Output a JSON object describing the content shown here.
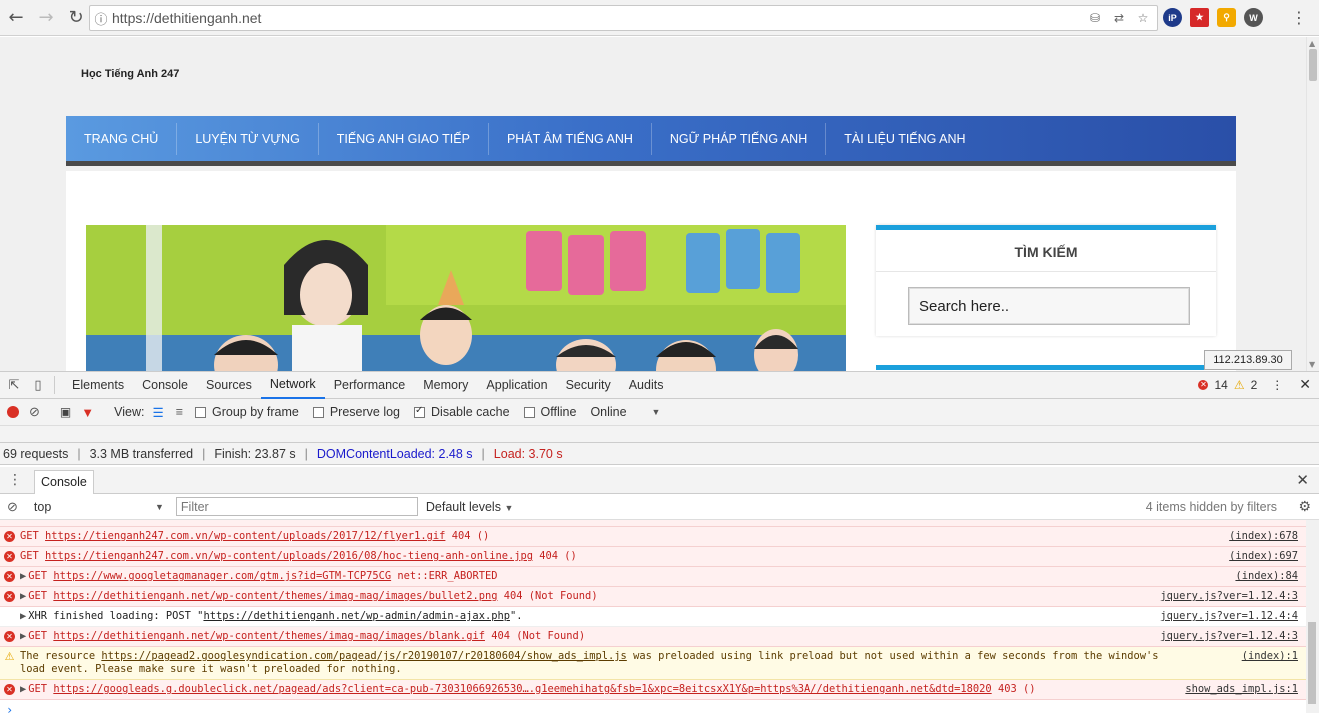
{
  "browser": {
    "url": "https://dethitienganh.net",
    "ext_labels": [
      "iP",
      "W"
    ]
  },
  "site": {
    "title": "Học Tiếng Anh 247",
    "nav": [
      "TRANG CHỦ",
      "LUYỆN TỪ VỰNG",
      "TIẾNG ANH GIAO TIẾP",
      "PHÁT ÂM TIẾNG ANH",
      "NGỮ PHÁP TIẾNG ANH",
      "TÀI LIỆU TIẾNG ANH"
    ],
    "widget_title": "TÌM KIẾM",
    "search_placeholder": "Search here..",
    "ip_tooltip": "112.213.89.30"
  },
  "devtools": {
    "tabs": [
      "Elements",
      "Console",
      "Sources",
      "Network",
      "Performance",
      "Memory",
      "Application",
      "Security",
      "Audits"
    ],
    "active_tab": "Network",
    "error_count": "14",
    "warning_count": "2",
    "network_toolbar": {
      "view_label": "View:",
      "group_by_frame": "Group by frame",
      "preserve_log": "Preserve log",
      "disable_cache": "Disable cache",
      "offline": "Offline",
      "throttle": "Online"
    },
    "summary": {
      "requests": "69 requests",
      "transferred": "3.3 MB transferred",
      "finish": "Finish: 23.87 s",
      "dcl": "DOMContentLoaded: 2.48 s",
      "load": "Load: 3.70 s"
    },
    "drawer_tab": "Console",
    "console_toolbar": {
      "context": "top",
      "filter_placeholder": "Filter",
      "levels": "Default levels",
      "hidden_note": "4 items hidden by filters"
    },
    "log": [
      {
        "type": "error",
        "expand": false,
        "method": "GET",
        "url": "https://tienganh247.com.vn/wp-content/uploads/2017/12/flyer1.gif",
        "status": "404 ()",
        "source": "(index):678"
      },
      {
        "type": "error",
        "expand": false,
        "method": "GET",
        "url": "https://tienganh247.com.vn/wp-content/uploads/2016/08/hoc-tieng-anh-online.jpg",
        "status": "404 ()",
        "source": "(index):697"
      },
      {
        "type": "error",
        "expand": true,
        "method": "GET",
        "url": "https://www.googletagmanager.com/gtm.js?id=GTM-TCP75CG",
        "status": "net::ERR_ABORTED",
        "source": "(index):84"
      },
      {
        "type": "error",
        "expand": true,
        "method": "GET",
        "url": "https://dethitienganh.net/wp-content/themes/imag-mag/images/bullet2.png",
        "status": "404 (Not Found)",
        "source": "jquery.js?ver=1.12.4:3"
      },
      {
        "type": "info",
        "expand": true,
        "text_pre": "XHR finished loading: POST \"",
        "url": "https://dethitienganh.net/wp-admin/admin-ajax.php",
        "text_post": "\".",
        "source": "jquery.js?ver=1.12.4:4"
      },
      {
        "type": "error",
        "expand": true,
        "method": "GET",
        "url": "https://dethitienganh.net/wp-content/themes/imag-mag/images/blank.gif",
        "status": "404 (Not Found)",
        "source": "jquery.js?ver=1.12.4:3"
      },
      {
        "type": "warn",
        "text_pre": "The resource ",
        "url": "https://pagead2.googlesyndication.com/pagead/js/r20190107/r20180604/show_ads_impl.js",
        "text_post": " was preloaded using link preload but not used within a few seconds from the window's load event. Please make sure it wasn't preloaded for nothing.",
        "source": "(index):1"
      },
      {
        "type": "error",
        "expand": true,
        "method": "GET",
        "url": "https://googleads.g.doubleclick.net/pagead/ads?client=ca-pub-73031066926530….g1eemehihatg&fsb=1&xpc=8eitcsxX1Y&p=https%3A//dethitienganh.net&dtd=18020",
        "status": "403 ()",
        "source": "show_ads_impl.js:1"
      }
    ]
  }
}
